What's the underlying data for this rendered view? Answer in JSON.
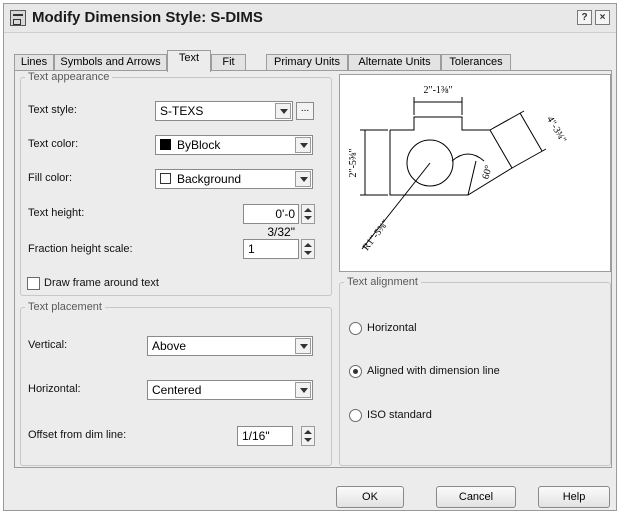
{
  "window": {
    "title": "Modify Dimension Style: S-DIMS",
    "help_label": "?",
    "close_label": "×"
  },
  "tabs": [
    {
      "label": "Lines"
    },
    {
      "label": "Symbols and Arrows"
    },
    {
      "label": "Text"
    },
    {
      "label": "Fit"
    },
    {
      "label": "Primary Units"
    },
    {
      "label": "Alternate Units"
    },
    {
      "label": "Tolerances"
    }
  ],
  "text_appearance": {
    "group_label": "Text appearance",
    "text_style": {
      "label": "Text style:",
      "value": "S-TEXS",
      "browse_label": "..."
    },
    "text_color": {
      "label": "Text color:",
      "value": "ByBlock",
      "swatch_color": "#000000"
    },
    "fill_color": {
      "label": "Fill color:",
      "value": "Background",
      "swatch_color": "#ffffff"
    },
    "text_height": {
      "label": "Text height:",
      "value": "0'-0 3/32\""
    },
    "fraction_height_scale": {
      "label": "Fraction height scale:",
      "value": "1"
    },
    "draw_frame": {
      "label": "Draw frame around text",
      "checked": false
    }
  },
  "text_placement": {
    "group_label": "Text placement",
    "vertical": {
      "label": "Vertical:",
      "value": "Above"
    },
    "horizontal": {
      "label": "Horizontal:",
      "value": "Centered"
    },
    "offset": {
      "label": "Offset from dim line:",
      "value": "1/16\""
    }
  },
  "preview": {
    "dim_top": "2\"-1⅜\"",
    "dim_left": "2\"-5⅝\"",
    "dim_right": "4\"-3¾\"",
    "dim_angle": "60°",
    "dim_radius": "R1\"-5⅜\""
  },
  "text_alignment": {
    "group_label": "Text alignment",
    "options": [
      {
        "label": "Horizontal",
        "selected": false
      },
      {
        "label": "Aligned with dimension line",
        "selected": true
      },
      {
        "label": "ISO standard",
        "selected": false
      }
    ]
  },
  "buttons": {
    "ok": "OK",
    "cancel": "Cancel",
    "help": "Help"
  }
}
